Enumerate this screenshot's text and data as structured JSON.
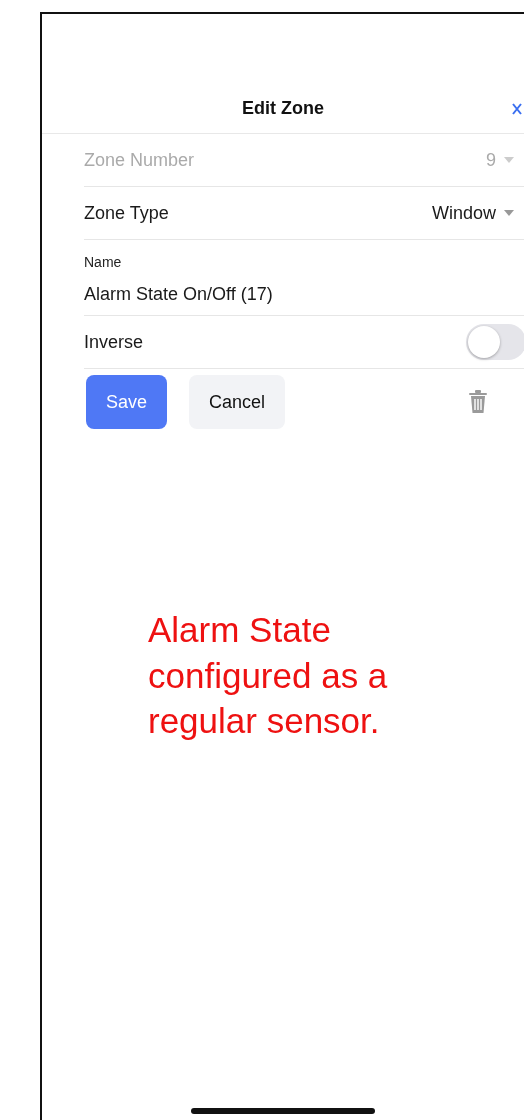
{
  "header": {
    "title": "Edit Zone"
  },
  "fields": [
    {
      "kind": "dropdown",
      "label": "Zone Number",
      "value": "9",
      "disabled": true
    },
    {
      "kind": "dropdown",
      "label": "Zone Type",
      "value": "Window",
      "disabled": false
    },
    {
      "kind": "text",
      "label": "Name",
      "value": "Alarm State On/Off (17)"
    },
    {
      "kind": "toggle",
      "label": "Inverse",
      "on": false
    }
  ],
  "buttons": [
    {
      "kind": "primary",
      "label": "Save"
    },
    {
      "kind": "secondary",
      "label": "Cancel"
    }
  ],
  "annotation": "Alarm State configured as a regular sensor."
}
